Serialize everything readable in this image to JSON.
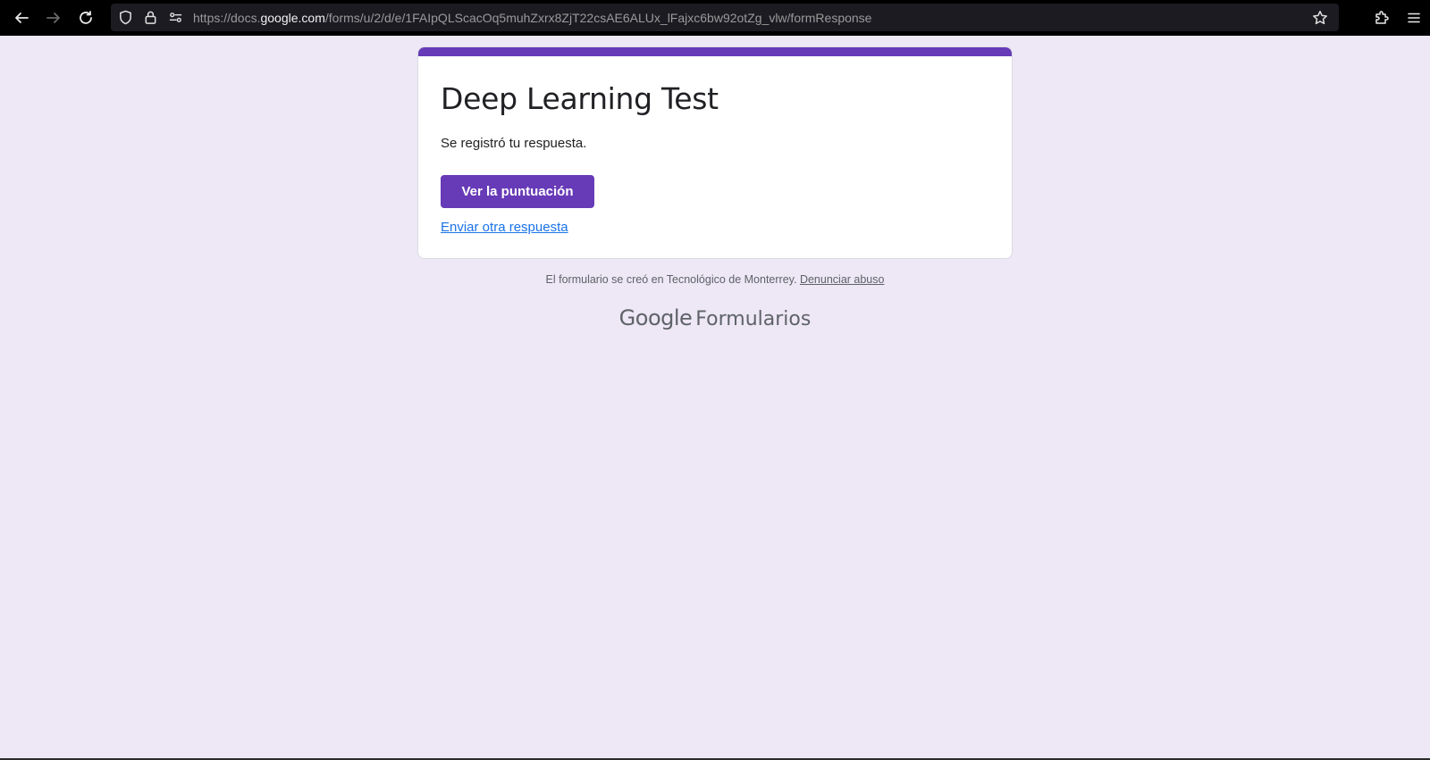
{
  "browser": {
    "url_prefix": "https://docs.",
    "url_host": "google.com",
    "url_path": "/forms/u/2/d/e/1FAIpQLScacOq5muhZxrx8ZjT22csAE6ALUx_lFajxc6bw92otZg_vlw/formResponse"
  },
  "form": {
    "title": "Deep Learning Test",
    "confirmation": "Se registró tu respuesta.",
    "score_button": "Ver la puntuación",
    "another_response": "Enviar otra respuesta",
    "accent_color": "#673ab7",
    "link_color": "#1a73e8"
  },
  "footer": {
    "note": "El formulario se creó en Tecnológico de Monterrey.",
    "report_abuse": "Denunciar abuso",
    "brand_google": "Google",
    "brand_product": "Formularios"
  },
  "icons": [
    "back-icon",
    "forward-icon",
    "reload-icon",
    "shield-icon",
    "lock-icon",
    "permissions-icon",
    "star-icon",
    "extensions-icon",
    "menu-icon"
  ]
}
